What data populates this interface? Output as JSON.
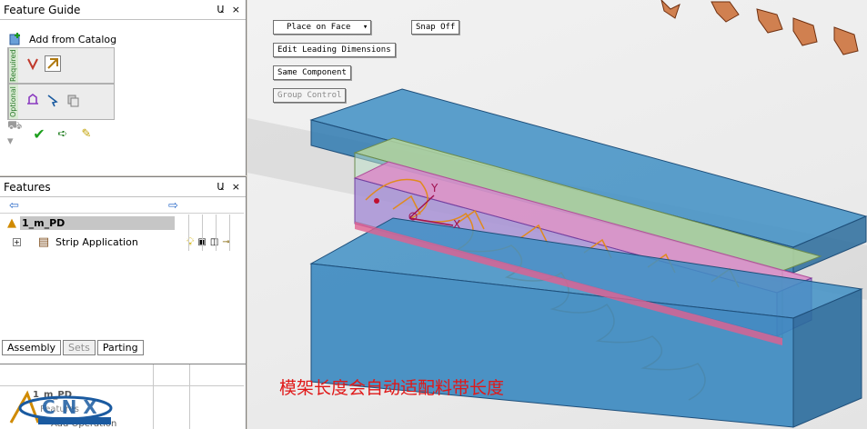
{
  "feature_guide": {
    "title": "Feature Guide",
    "pin": "Ա",
    "close": "×",
    "add_from_catalog": "Add from Catalog",
    "required_label": "Required",
    "optional_label": "Optional"
  },
  "features": {
    "title": "Features",
    "pin": "Ա",
    "close": "×",
    "root_label": "1_m_PD",
    "item_label": "Strip Application",
    "expand": "+"
  },
  "tabs": {
    "assembly": "Assembly",
    "sets": "Sets",
    "parting": "Parting"
  },
  "lower": {
    "row1": "1_m_PD",
    "row2": "Features",
    "row3": "Add Operation"
  },
  "viewport": {
    "place_on_face": "Place on Face",
    "snap_off": "Snap Off",
    "edit_leading_dims": "Edit Leading Dimensions",
    "same_component": "Same Component",
    "group_control": "Group Control",
    "axis_y": "Y",
    "axis_x": "X",
    "caption": "模架长度会自动适配料带长度"
  },
  "colors": {
    "plate_blue": "#3f8fc4",
    "strip_pink": "#d98ac8",
    "outline_orange": "#e08a1e",
    "caption_red": "#e01818"
  }
}
